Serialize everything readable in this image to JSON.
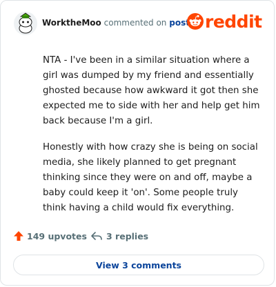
{
  "header": {
    "username": "WorktheMoo",
    "action": "commented on",
    "post_link": "post",
    "brand": "reddit"
  },
  "comment": {
    "paragraphs": [
      "NTA - I've been in a similar situation where a girl was dumped by my friend and essentially ghosted because how awkward it got then she expected me to side with her and help get him back because I'm a girl.",
      "Honestly with how crazy she is being on social media, she likely planned to get pregnant thinking since they were on and off, maybe a baby could keep it 'on'. Some people truly think having a child would fix everything."
    ]
  },
  "footer": {
    "upvotes": "149 upvotes",
    "replies": "3 replies",
    "view_comments": "View 3 comments"
  },
  "colors": {
    "brand": "#ff4500",
    "link": "#0a449b",
    "muted": "#576f76"
  }
}
